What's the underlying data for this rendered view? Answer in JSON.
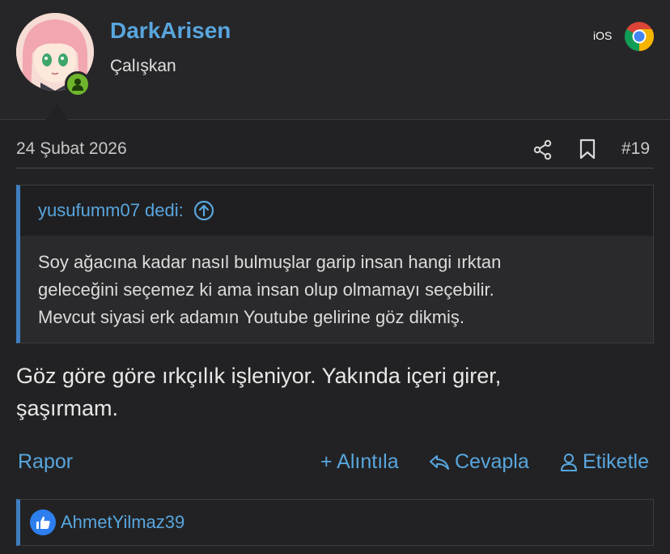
{
  "user": {
    "name": "DarkArisen",
    "title": "Çalışkan",
    "platform": "iOS",
    "browser_icon": "chrome-icon",
    "status_icon": "user-online-icon"
  },
  "post": {
    "date": "24 Şubat 2026",
    "number": "#19",
    "share_icon": "share-icon",
    "bookmark_icon": "bookmark-icon"
  },
  "quote": {
    "author": "yusufumm07 dedi:",
    "lines": [
      "Soy ağacına kadar nasıl bulmuşlar garip insan hangi ırktan",
      "geleceğini seçemez ki ama insan olup olmamayı seçebilir.",
      "Mevcut siyasi erk adamın Youtube gelirine göz dikmiş."
    ]
  },
  "message": {
    "lines": [
      "Göz göre göre ırkçılık işleniyor. Yakında içeri girer,",
      "şaşırmam."
    ]
  },
  "actions": {
    "report": "Rapor",
    "quote": "+ Alıntıla",
    "reply": "Cevapla",
    "tag": "Etiketle"
  },
  "reactions": {
    "icon": "like-icon",
    "user": "AhmetYilmaz39"
  },
  "colors": {
    "accent": "#58a6de",
    "quote_border": "#3f7fc0",
    "online": "#6fb52c",
    "like": "#2d7ff0",
    "background": "#222224"
  }
}
